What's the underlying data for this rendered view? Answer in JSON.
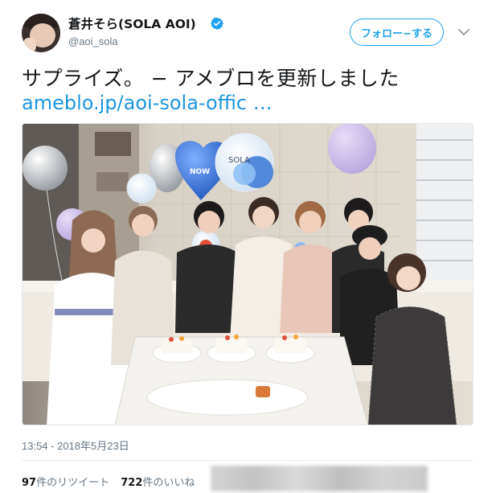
{
  "user": {
    "display_name": "蒼井そら(SOLA AOI)",
    "handle": "@aoi_sola",
    "verified": true,
    "avatar_icon": "profile-photo"
  },
  "actions": {
    "follow_label": "フォロー−する",
    "menu_icon": "chevron-down-icon"
  },
  "tweet": {
    "text": "サプライズ。 − アメブロを更新しました",
    "link": "ameblo.jp/aoi-sola-offic …",
    "photo_balloon_text": "SOLA",
    "photo_balloon_text_2": "NOW"
  },
  "meta": {
    "timestamp": "13:54 - 2018年5月23日",
    "retweets_count": "97",
    "retweets_label": "件のリツイート",
    "likes_count": "722",
    "likes_label": "件のいいね"
  },
  "colors": {
    "accent": "#1da1f2",
    "link": "#1b95e0",
    "secondary_text": "#657786",
    "primary_text": "#14171a"
  }
}
